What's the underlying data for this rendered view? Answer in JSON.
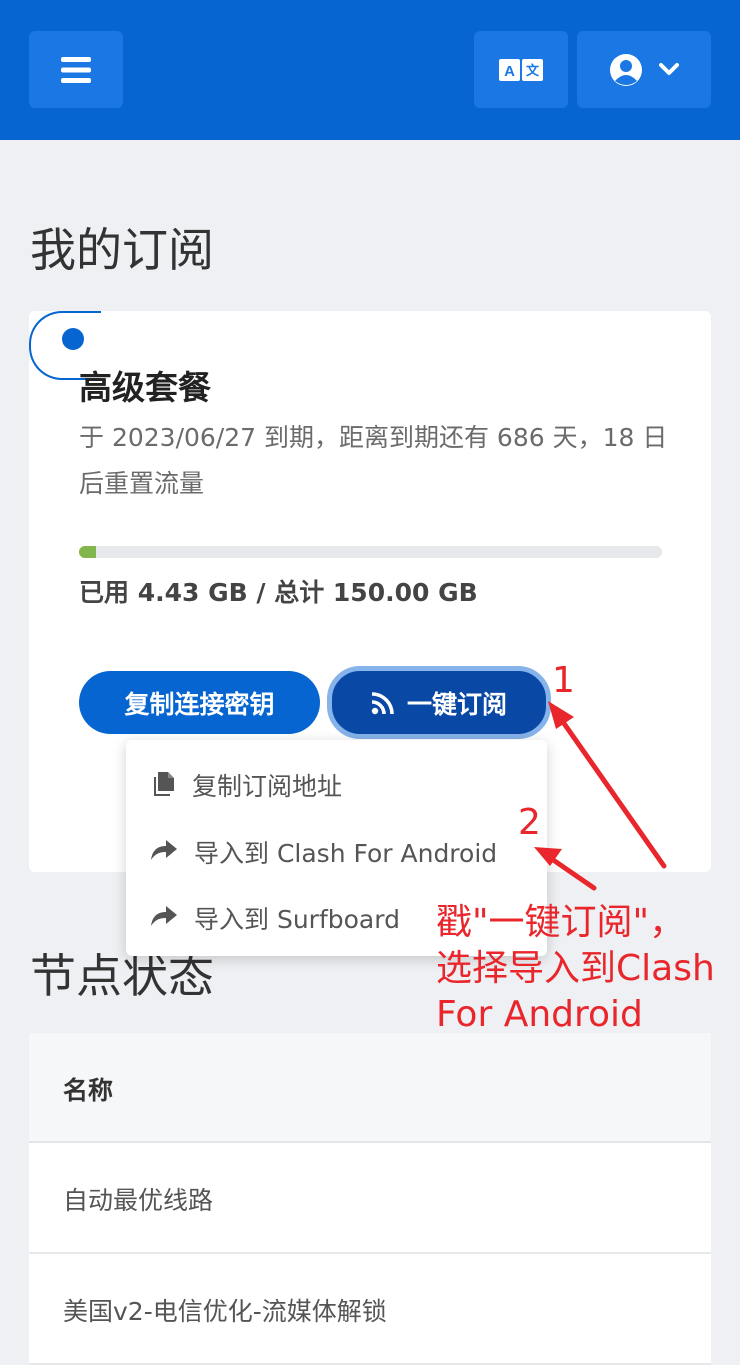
{
  "header": {
    "menu_icon": "hamburger-icon",
    "lang_icon": "translate-icon",
    "user_icon": "user-circle-icon",
    "chevron_icon": "chevron-down-icon"
  },
  "page": {
    "title": "我的订阅"
  },
  "subscription": {
    "plan_name": "高级套餐",
    "description": "于 2023/06/27 到期，距离到期还有 686 天，18 日后重置流量",
    "usage_text": "已用 4.43 GB / 总计 150.00 GB",
    "used_gb": 4.43,
    "total_gb": 150.0,
    "progress_fraction": 0.0295,
    "progress_color": "#82b54b",
    "copy_key_label": "复制连接密钥",
    "oneclick_label": "一键订阅"
  },
  "dropdown": {
    "items": [
      {
        "label": "复制订阅地址",
        "icon": "copy-icon"
      },
      {
        "label": "导入到 Clash For Android",
        "icon": "share-arrow-icon"
      },
      {
        "label": "导入到 Surfboard",
        "icon": "share-arrow-icon"
      }
    ]
  },
  "nodes": {
    "title": "节点状态",
    "header_name": "名称",
    "rows": [
      "自动最优线路",
      "美国v2-电信优化-流媒体解锁"
    ]
  },
  "annotation": {
    "num1": "1",
    "num2": "2",
    "text": "戳\"一键订阅\"，\n选择导入到Clash\nFor Android",
    "color": "#e8262b"
  },
  "colors": {
    "primary": "#0665d0",
    "dark_primary": "#0a48a6"
  }
}
